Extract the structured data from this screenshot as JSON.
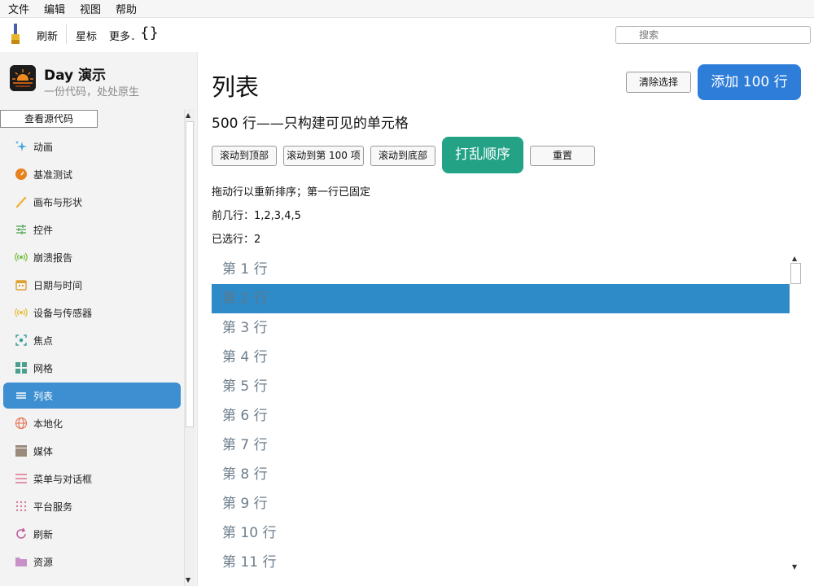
{
  "menu": [
    "文件",
    "编辑",
    "视图",
    "帮助"
  ],
  "toolbar": {
    "refresh": "刷新",
    "star": "星标",
    "more": "更多",
    "braces": "{}",
    "search_placeholder": "搜索"
  },
  "sidebar": {
    "app_title": "Day 演示",
    "app_subtitle": "一份代码，处处原生",
    "view_source": "查看源代码",
    "items": [
      {
        "label": "",
        "icon": "circle-icon",
        "color": "#4a6fa5"
      },
      {
        "label": "动画",
        "icon": "sparkle-icon",
        "color": "#4aa3e0"
      },
      {
        "label": "基准测试",
        "icon": "gauge-icon",
        "color": "#e8821e"
      },
      {
        "label": "画布与形状",
        "icon": "brush-icon",
        "color": "#f0b23a"
      },
      {
        "label": "控件",
        "icon": "sliders-icon",
        "color": "#5aa85a"
      },
      {
        "label": "崩溃报告",
        "icon": "broadcast-icon",
        "color": "#7cc04a"
      },
      {
        "label": "日期与时间",
        "icon": "calendar-icon",
        "color": "#e0a030"
      },
      {
        "label": "设备与传感器",
        "icon": "sensor-icon",
        "color": "#e8c040"
      },
      {
        "label": "焦点",
        "icon": "focus-icon",
        "color": "#3aa0a0"
      },
      {
        "label": "网格",
        "icon": "grid-icon",
        "color": "#4aa090"
      },
      {
        "label": "列表",
        "icon": "list-icon",
        "color": "#ffffff",
        "active": true
      },
      {
        "label": "本地化",
        "icon": "globe-icon",
        "color": "#e87a5a"
      },
      {
        "label": "媒体",
        "icon": "clapper-icon",
        "color": "#9a8a7a"
      },
      {
        "label": "菜单与对话框",
        "icon": "menu-icon",
        "color": "#d86a8a"
      },
      {
        "label": "平台服务",
        "icon": "dots-grid-icon",
        "color": "#d87aa0"
      },
      {
        "label": "刷新",
        "icon": "refresh-icon",
        "color": "#c05a9a"
      },
      {
        "label": "资源",
        "icon": "folder-icon",
        "color": "#c890c8"
      }
    ]
  },
  "main": {
    "title": "列表",
    "clear_selection": "清除选择",
    "add_rows": "添加 100 行",
    "subtitle": "500 行——只构建可见的单元格",
    "buttons": {
      "scroll_top": "滚动到顶部",
      "scroll_100": "滚动到第 100 项",
      "scroll_bottom": "滚动到底部",
      "shuffle": "打乱顺序",
      "reset": "重置"
    },
    "hint": "拖动行以重新排序；第一行已固定",
    "first_rows": "前几行：1,2,3,4,5",
    "selected": "已选行：2",
    "rows": [
      "第 1 行",
      "第 2 行",
      "第 3 行",
      "第 4 行",
      "第 5 行",
      "第 6 行",
      "第 7 行",
      "第 8 行",
      "第 9 行",
      "第 10 行",
      "第 11 行"
    ],
    "selected_index": 1
  },
  "colors": {
    "accent_blue": "#2e7ed9",
    "accent_green": "#23a286",
    "selection": "#2f8bc8",
    "sidebar_active": "#3d8fd1"
  }
}
